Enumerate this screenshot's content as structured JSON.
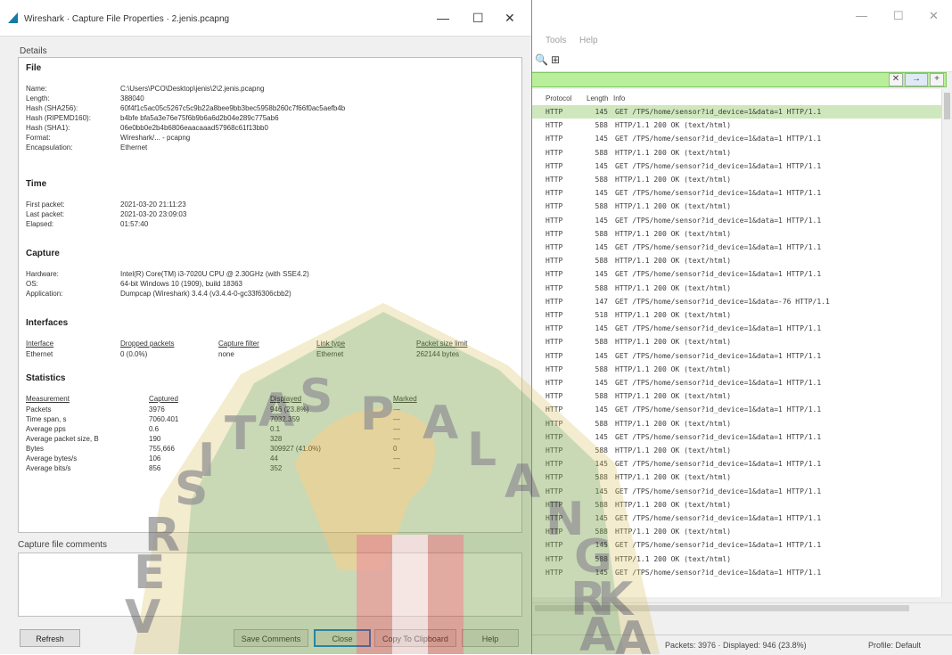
{
  "dialog": {
    "title": "Wireshark · Capture File Properties · 2.jenis.pcapng",
    "minimize_glyph": "—",
    "maximize_glyph": "☐",
    "close_glyph": "✕",
    "details_label": "Details",
    "comments_label": "Capture file comments",
    "file": {
      "heading": "File",
      "name_label": "Name:",
      "name_value": "C:\\Users\\PCO\\Desktop\\jenis\\2\\2.jenis.pcapng",
      "length_label": "Length:",
      "length_value": "388040",
      "sha256_label": "Hash (SHA256):",
      "sha256_value": "60f4f1c5ac05c5267c5c9b22a8bee9bb3bec5958b260c7f66f0ac5aefb4b",
      "ripemd_label": "Hash (RIPEMD160):",
      "ripemd_value": "b4bfe bfa5a3e76e75f6b9b6a6d2b04e289c775ab6",
      "sha1_label": "Hash (SHA1):",
      "sha1_value": "06e0bb0e2b4b6806eaacaaad57968c61f13bb0",
      "format_label": "Format:",
      "format_value": "Wireshark/... - pcapng",
      "encap_label": "Encapsulation:",
      "encap_value": "Ethernet"
    },
    "time": {
      "heading": "Time",
      "first_label": "First packet:",
      "first_value": "2021-03-20 21:11:23",
      "last_label": "Last packet:",
      "last_value": "2021-03-20 23:09:03",
      "elapsed_label": "Elapsed:",
      "elapsed_value": "01:57:40"
    },
    "capture": {
      "heading": "Capture",
      "hw_label": "Hardware:",
      "hw_value": "Intel(R) Core(TM) i3-7020U CPU @ 2.30GHz (with SSE4.2)",
      "os_label": "OS:",
      "os_value": "64-bit Windows 10 (1909), build 18363",
      "app_label": "Application:",
      "app_value": "Dumpcap (Wireshark) 3.4.4 (v3.4.4-0-gc33f6306cbb2)"
    },
    "interfaces": {
      "heading": "Interfaces",
      "headers": [
        "Interface",
        "Dropped packets",
        "Capture filter",
        "Link type",
        "Packet size limit"
      ],
      "row": [
        "Ethernet",
        "0 (0.0%)",
        "none",
        "Ethernet",
        "262144 bytes"
      ]
    },
    "statistics": {
      "heading": "Statistics",
      "headers": [
        "Measurement",
        "Captured",
        "Displayed",
        "Marked"
      ],
      "rows": [
        [
          "Packets",
          "3976",
          "946 (23.8%)",
          "—"
        ],
        [
          "Time span, s",
          "7060.401",
          "7032.359",
          "—"
        ],
        [
          "Average pps",
          "0.6",
          "0.1",
          "—"
        ],
        [
          "Average packet size, B",
          "190",
          "328",
          "—"
        ],
        [
          "Bytes",
          "755,666",
          "309927 (41.0%)",
          "0"
        ],
        [
          "Average bytes/s",
          "106",
          "44",
          "—"
        ],
        [
          "Average bits/s",
          "856",
          "352",
          "—"
        ]
      ]
    },
    "buttons": {
      "refresh": "Refresh",
      "save_comments": "Save Comments",
      "close": "Close",
      "copy": "Copy To Clipboard",
      "help": "Help"
    }
  },
  "main_window": {
    "menu_tools": "Tools",
    "menu_help": "Help",
    "window_min": "—",
    "window_max": "☐",
    "window_close": "✕",
    "zoom_icon_glyph": "🔍",
    "resize_icon_glyph": "⊞",
    "filter_clear_glyph": "✕",
    "filter_arrow_glyph": "→",
    "filter_plus_glyph": "+",
    "packet_list": {
      "headers": [
        "Protocol",
        "Length",
        "Info"
      ],
      "rows": [
        [
          "HTTP",
          "145",
          "GET /TPS/home/sensor?id_device=1&data=1 HTTP/1.1"
        ],
        [
          "HTTP",
          "588",
          "HTTP/1.1 200 OK  (text/html)"
        ],
        [
          "HTTP",
          "145",
          "GET /TPS/home/sensor?id_device=1&data=1 HTTP/1.1"
        ],
        [
          "HTTP",
          "588",
          "HTTP/1.1 200 OK  (text/html)"
        ],
        [
          "HTTP",
          "145",
          "GET /TPS/home/sensor?id_device=1&data=1 HTTP/1.1"
        ],
        [
          "HTTP",
          "588",
          "HTTP/1.1 200 OK  (text/html)"
        ],
        [
          "HTTP",
          "145",
          "GET /TPS/home/sensor?id_device=1&data=1 HTTP/1.1"
        ],
        [
          "HTTP",
          "588",
          "HTTP/1.1 200 OK  (text/html)"
        ],
        [
          "HTTP",
          "145",
          "GET /TPS/home/sensor?id_device=1&data=1 HTTP/1.1"
        ],
        [
          "HTTP",
          "588",
          "HTTP/1.1 200 OK  (text/html)"
        ],
        [
          "HTTP",
          "145",
          "GET /TPS/home/sensor?id_device=1&data=1 HTTP/1.1"
        ],
        [
          "HTTP",
          "588",
          "HTTP/1.1 200 OK  (text/html)"
        ],
        [
          "HTTP",
          "145",
          "GET /TPS/home/sensor?id_device=1&data=1 HTTP/1.1"
        ],
        [
          "HTTP",
          "588",
          "HTTP/1.1 200 OK  (text/html)"
        ],
        [
          "HTTP",
          "147",
          "GET /TPS/home/sensor?id_device=1&data=-76 HTTP/1.1"
        ],
        [
          "HTTP",
          "518",
          "HTTP/1.1 200 OK  (text/html)"
        ],
        [
          "HTTP",
          "145",
          "GET /TPS/home/sensor?id_device=1&data=1 HTTP/1.1"
        ],
        [
          "HTTP",
          "588",
          "HTTP/1.1 200 OK  (text/html)"
        ],
        [
          "HTTP",
          "145",
          "GET /TPS/home/sensor?id_device=1&data=1 HTTP/1.1"
        ],
        [
          "HTTP",
          "588",
          "HTTP/1.1 200 OK  (text/html)"
        ],
        [
          "HTTP",
          "145",
          "GET /TPS/home/sensor?id_device=1&data=1 HTTP/1.1"
        ],
        [
          "HTTP",
          "588",
          "HTTP/1.1 200 OK  (text/html)"
        ],
        [
          "HTTP",
          "145",
          "GET /TPS/home/sensor?id_device=1&data=1 HTTP/1.1"
        ],
        [
          "HTTP",
          "588",
          "HTTP/1.1 200 OK  (text/html)"
        ],
        [
          "HTTP",
          "145",
          "GET /TPS/home/sensor?id_device=1&data=1 HTTP/1.1"
        ],
        [
          "HTTP",
          "588",
          "HTTP/1.1 200 OK  (text/html)"
        ],
        [
          "HTTP",
          "145",
          "GET /TPS/home/sensor?id_device=1&data=1 HTTP/1.1"
        ],
        [
          "HTTP",
          "588",
          "HTTP/1.1 200 OK  (text/html)"
        ],
        [
          "HTTP",
          "145",
          "GET /TPS/home/sensor?id_device=1&data=1 HTTP/1.1"
        ],
        [
          "HTTP",
          "588",
          "HTTP/1.1 200 OK  (text/html)"
        ],
        [
          "HTTP",
          "145",
          "GET /TPS/home/sensor?id_device=1&data=1 HTTP/1.1"
        ],
        [
          "HTTP",
          "588",
          "HTTP/1.1 200 OK  (text/html)"
        ],
        [
          "HTTP",
          "145",
          "GET /TPS/home/sensor?id_device=1&data=1 HTTP/1.1"
        ],
        [
          "HTTP",
          "588",
          "HTTP/1.1 200 OK  (text/html)"
        ],
        [
          "HTTP",
          "145",
          "GET /TPS/home/sensor?id_device=1&data=1 HTTP/1.1"
        ]
      ]
    },
    "status": {
      "packets": "Packets: 3976 · Displayed: 946 (23.8%)",
      "profile": "Profile: Default"
    }
  },
  "watermark": {
    "letters_top": [
      "P",
      "A",
      "L",
      "A",
      "N",
      "G",
      "K",
      "A"
    ],
    "letters_left": [
      "S",
      "I",
      "T",
      "A",
      "S"
    ],
    "letters_bottom_left": [
      "E",
      "R",
      "V"
    ],
    "letters_right": [
      "R",
      "A"
    ]
  }
}
